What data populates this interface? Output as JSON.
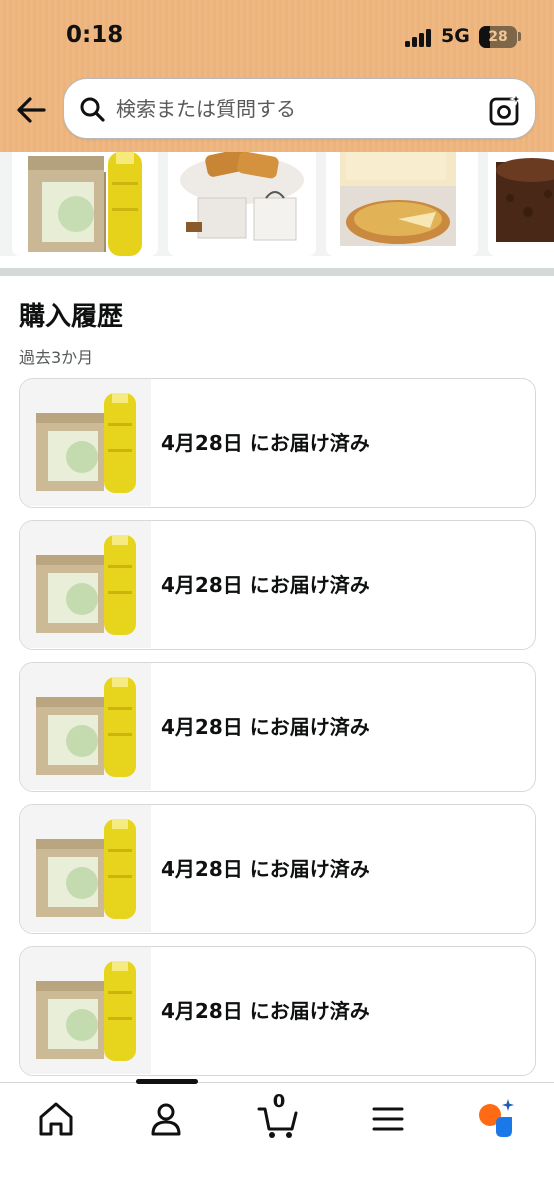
{
  "status_bar": {
    "time": "0:18",
    "network": "5G",
    "battery": "28"
  },
  "header": {
    "back_icon": "arrow-left-icon",
    "search": {
      "placeholder": "検索または質問する",
      "value": ""
    },
    "camera_icon": "camera-sparkle-icon"
  },
  "carousel": {
    "items": [
      {
        "icon": "tea-bottle-case-image"
      },
      {
        "icon": "pastry-box-image"
      },
      {
        "icon": "cheese-tart-image"
      },
      {
        "icon": "chocolate-cake-image"
      }
    ]
  },
  "purchase_history": {
    "title": "購入履歴",
    "subtitle": "過去3か月",
    "orders": [
      {
        "status": "4月28日 にお届け済み"
      },
      {
        "status": "4月28日 にお届け済み"
      },
      {
        "status": "4月28日 にお届け済み"
      },
      {
        "status": "4月28日 にお届け済み"
      },
      {
        "status": "4月28日 にお届け済み"
      }
    ]
  },
  "bottom_nav": {
    "items": [
      {
        "icon": "home-icon"
      },
      {
        "icon": "account-icon"
      },
      {
        "icon": "cart-icon",
        "count": "0"
      },
      {
        "icon": "menu-icon"
      },
      {
        "icon": "rufus-icon"
      }
    ]
  },
  "colors": {
    "header_bg": "#efb882",
    "accent_orange": "#ff6a14",
    "accent_blue": "#1a78e8"
  }
}
